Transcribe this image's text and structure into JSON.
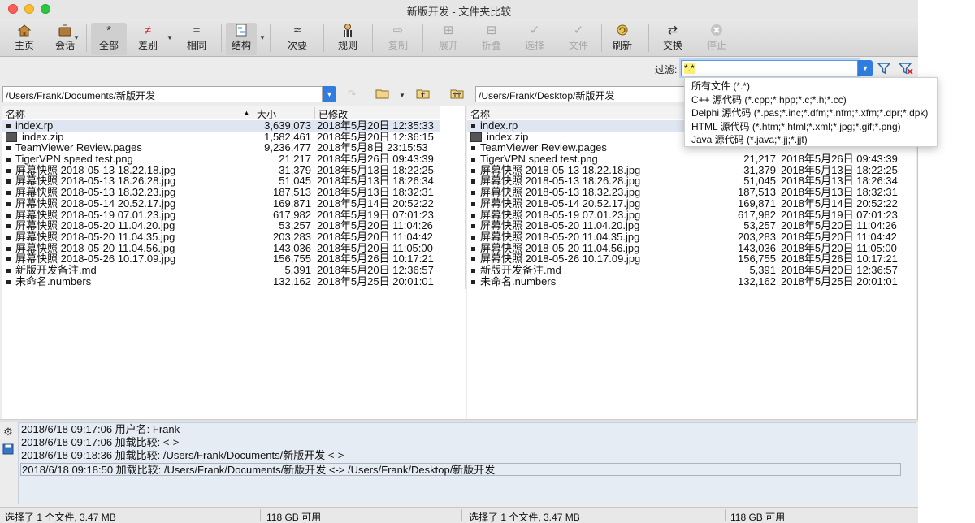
{
  "window": {
    "title": "新版开发 - 文件夹比较"
  },
  "toolbar": {
    "home": {
      "label": "主页",
      "icon": "house-icon"
    },
    "session": {
      "label": "会话",
      "icon": "briefcase-icon"
    },
    "all": {
      "label": "全部",
      "glyph": "*"
    },
    "diffs": {
      "label": "差别",
      "glyph": "≠"
    },
    "same": {
      "label": "相同",
      "glyph": "="
    },
    "structure": {
      "label": "结构",
      "icon": "folder-structure-icon"
    },
    "minor": {
      "label": "次要",
      "glyph": "≈"
    },
    "rules": {
      "label": "规则",
      "icon": "referee-icon"
    },
    "copy": {
      "label": "复制",
      "glyph": "⇨"
    },
    "expand": {
      "label": "展开",
      "glyph": "⊞"
    },
    "collapse": {
      "label": "折叠",
      "glyph": "⊟"
    },
    "select": {
      "label": "选择",
      "glyph": "✓"
    },
    "files": {
      "label": "文件",
      "glyph": "✓"
    },
    "refresh": {
      "label": "刷新",
      "icon": "refresh-icon"
    },
    "swap": {
      "label": "交换",
      "glyph": "⇄"
    },
    "stop": {
      "label": "停止",
      "glyph": "✕"
    }
  },
  "filter": {
    "label": "过滤:",
    "value": "*.*"
  },
  "filter_menu": [
    "所有文件 (*.*)",
    "C++ 源代码 (*.cpp;*.hpp;*.c;*.h;*.cc)",
    "Delphi 源代码 (*.pas;*.inc;*.dfm;*.nfm;*.xfm;*.dpr;*.dpk)",
    "HTML 源代码 (*.htm;*.html;*.xml;*.jpg;*.gif;*.png)",
    "Java 源代码 (*.java;*.jj;*.jjt)"
  ],
  "left": {
    "path": "/Users/Frank/Documents/新版开发",
    "headers": {
      "name": "名称",
      "size": "大小",
      "modified": "已修改"
    },
    "files": [
      {
        "name": "index.rp",
        "size": "3,639,073",
        "modified": "2018年5月20日 12:35:33",
        "selected": true
      },
      {
        "name": "index.zip",
        "size": "1,582,461",
        "modified": "2018年5月20日 12:36:15",
        "zip": true
      },
      {
        "name": "TeamViewer Review.pages",
        "size": "9,236,477",
        "modified": "2018年5月8日 23:15:53"
      },
      {
        "name": "TigerVPN speed test.png",
        "size": "21,217",
        "modified": "2018年5月26日 09:43:39"
      },
      {
        "name": "屏幕快照 2018-05-13 18.22.18.jpg",
        "size": "31,379",
        "modified": "2018年5月13日 18:22:25"
      },
      {
        "name": "屏幕快照 2018-05-13 18.26.28.jpg",
        "size": "51,045",
        "modified": "2018年5月13日 18:26:34"
      },
      {
        "name": "屏幕快照 2018-05-13 18.32.23.jpg",
        "size": "187,513",
        "modified": "2018年5月13日 18:32:31"
      },
      {
        "name": "屏幕快照 2018-05-14 20.52.17.jpg",
        "size": "169,871",
        "modified": "2018年5月14日 20:52:22"
      },
      {
        "name": "屏幕快照 2018-05-19 07.01.23.jpg",
        "size": "617,982",
        "modified": "2018年5月19日 07:01:23"
      },
      {
        "name": "屏幕快照 2018-05-20 11.04.20.jpg",
        "size": "53,257",
        "modified": "2018年5月20日 11:04:26"
      },
      {
        "name": "屏幕快照 2018-05-20 11.04.35.jpg",
        "size": "203,283",
        "modified": "2018年5月20日 11:04:42"
      },
      {
        "name": "屏幕快照 2018-05-20 11.04.56.jpg",
        "size": "143,036",
        "modified": "2018年5月20日 11:05:00"
      },
      {
        "name": "屏幕快照 2018-05-26 10.17.09.jpg",
        "size": "156,755",
        "modified": "2018年5月26日 10:17:21"
      },
      {
        "name": "新版开发备注.md",
        "size": "5,391",
        "modified": "2018年5月20日 12:36:57"
      },
      {
        "name": "未命名.numbers",
        "size": "132,162",
        "modified": "2018年5月25日 20:01:01"
      }
    ]
  },
  "right": {
    "path": "/Users/Frank/Desktop/新版开发",
    "headers": {
      "name": "名称"
    },
    "files": [
      {
        "name": "index.rp",
        "size": "",
        "modified": "",
        "selected": true
      },
      {
        "name": "index.zip",
        "size": "",
        "modified": "",
        "zip": true
      },
      {
        "name": "TeamViewer Review.pages",
        "size": "",
        "modified": ""
      },
      {
        "name": "TigerVPN speed test.png",
        "size": "21,217",
        "modified": "2018年5月26日 09:43:39"
      },
      {
        "name": "屏幕快照 2018-05-13 18.22.18.jpg",
        "size": "31,379",
        "modified": "2018年5月13日 18:22:25"
      },
      {
        "name": "屏幕快照 2018-05-13 18.26.28.jpg",
        "size": "51,045",
        "modified": "2018年5月13日 18:26:34"
      },
      {
        "name": "屏幕快照 2018-05-13 18.32.23.jpg",
        "size": "187,513",
        "modified": "2018年5月13日 18:32:31"
      },
      {
        "name": "屏幕快照 2018-05-14 20.52.17.jpg",
        "size": "169,871",
        "modified": "2018年5月14日 20:52:22"
      },
      {
        "name": "屏幕快照 2018-05-19 07.01.23.jpg",
        "size": "617,982",
        "modified": "2018年5月19日 07:01:23"
      },
      {
        "name": "屏幕快照 2018-05-20 11.04.20.jpg",
        "size": "53,257",
        "modified": "2018年5月20日 11:04:26"
      },
      {
        "name": "屏幕快照 2018-05-20 11.04.35.jpg",
        "size": "203,283",
        "modified": "2018年5月20日 11:04:42"
      },
      {
        "name": "屏幕快照 2018-05-20 11.04.56.jpg",
        "size": "143,036",
        "modified": "2018年5月20日 11:05:00"
      },
      {
        "name": "屏幕快照 2018-05-26 10.17.09.jpg",
        "size": "156,755",
        "modified": "2018年5月26日 10:17:21"
      },
      {
        "name": "新版开发备注.md",
        "size": "5,391",
        "modified": "2018年5月20日 12:36:57"
      },
      {
        "name": "未命名.numbers",
        "size": "132,162",
        "modified": "2018年5月25日 20:01:01"
      }
    ]
  },
  "log": [
    "2018/6/18 09:17:06  用户名: Frank",
    "2018/6/18 09:17:06  加载比较: <->",
    "2018/6/18 09:18:36  加载比较: /Users/Frank/Documents/新版开发 <->",
    "2018/6/18 09:18:50  加载比较: /Users/Frank/Documents/新版开发 <-> /Users/Frank/Desktop/新版开发"
  ],
  "status": {
    "left_selection": "选择了 1 个文件, 3.47 MB",
    "left_free": "118 GB 可用",
    "right_selection": "选择了 1 个文件, 3.47 MB",
    "right_free": "118 GB 可用"
  },
  "colors": {
    "accent": "#2f7de1",
    "selection": "#dfe6f2",
    "log_bg": "#e6ecf4"
  }
}
